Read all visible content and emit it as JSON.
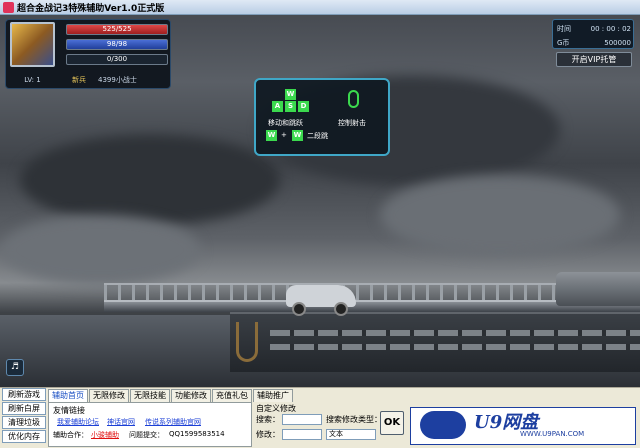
{
  "window": {
    "title": "超合金战记3特殊辅助Ver1.0正式版"
  },
  "player": {
    "hp": "525/525",
    "mp": "98/98",
    "xp": "0/300",
    "hp_fraction": 1.0,
    "mp_fraction": 1.0,
    "xp_fraction": 0.0,
    "level": "LV: 1",
    "rank": "新兵",
    "name": "4399小战士"
  },
  "status_panel": {
    "time_label": "时间",
    "time_value": "00 : 00 : 02",
    "coin_label": "G币",
    "coin_value": "500000"
  },
  "vip_button": "开启VIP托管",
  "tutorial": {
    "keys_top": "W",
    "keys_row": [
      "A",
      "S",
      "D"
    ],
    "move_label": "移动和跳跃",
    "double_jump_label": "二段跳",
    "combo_key_1": "W",
    "combo_plus": "+",
    "combo_key_2": "W",
    "shoot_label": "控制射击"
  },
  "toolbar": {
    "left_buttons": [
      "刷新游戏",
      "刷新白屏",
      "清理垃圾",
      "优化内存"
    ],
    "tabs": [
      "辅助首页",
      "无限修改",
      "无限技能",
      "功能修改",
      "充值礼包",
      "辅助推广"
    ],
    "active_tab": "辅助首页",
    "friend_links_title": "友情链接",
    "links": [
      "我爱辅助论坛",
      "神话官网",
      "传说系列辅助官网"
    ],
    "partner_label": "辅助合作：",
    "partner_value": "小骏辅助",
    "question_label": "问题提交：",
    "question_value": "QQ1599583514",
    "custom_title": "自定义修改",
    "search_label": "搜索：",
    "search_type_label": "搜索修改类型：",
    "modify_label": "修改：",
    "type_value": "文本",
    "ok_label": "OK",
    "ad_title": "U9网盘",
    "ad_sub": "WWW.U9PAN.COM"
  }
}
